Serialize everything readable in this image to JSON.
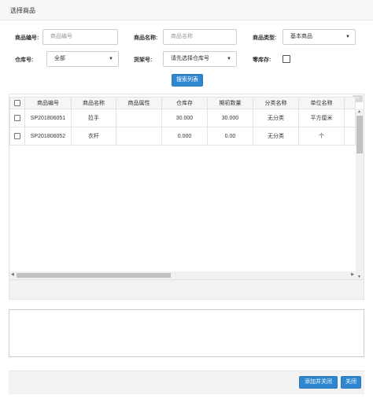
{
  "dialog": {
    "title": "选择商品"
  },
  "filters": {
    "code_label": "商品编号:",
    "code_placeholder": "商品编号",
    "name_label": "商品名称:",
    "name_placeholder": "商品名称",
    "type_label": "商品类型:",
    "type_value": "基本商品",
    "warehouse_label": "仓库号:",
    "warehouse_value": "全部",
    "shelf_label": "货架号:",
    "shelf_value": "请先选择仓库号",
    "zero_stock_label": "零库存:",
    "search_button": "搜索列表"
  },
  "table": {
    "columns": [
      "商品编号",
      "商品名称",
      "商品属性",
      "仓库存",
      "期初数量",
      "分类名称",
      "单位名称"
    ],
    "rows": [
      [
        "SP201806051",
        "拉手",
        "",
        "30.000",
        "30.000",
        "无分类",
        "平方厘米"
      ],
      [
        "SP201806052",
        "衣杆",
        "",
        "0.000",
        "0.00",
        "无分类",
        "个"
      ]
    ]
  },
  "remarks": {
    "value": ""
  },
  "footer": {
    "add_close_button": "添加并关闭",
    "close_button": "关闭"
  },
  "icons": {
    "collapse": "double-chevron-left-icon",
    "caret": "triangle-down-icon"
  },
  "colors": {
    "primary": "#2f87cf",
    "border": "#cccccc",
    "panel_bg": "#f2f2f2"
  }
}
